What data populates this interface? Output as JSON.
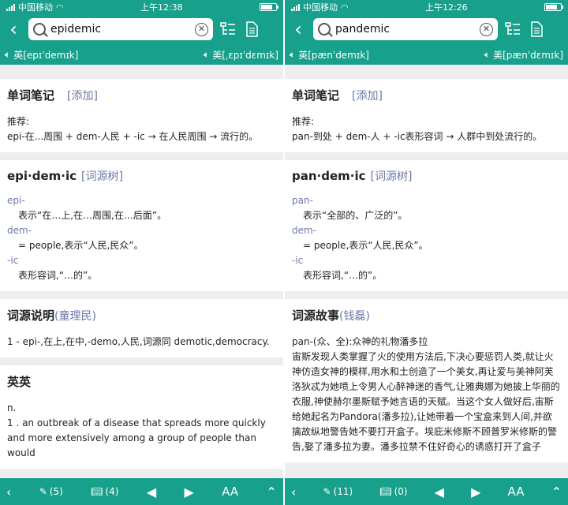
{
  "left": {
    "status": {
      "carrier": "中国移动",
      "time": "上午12:38"
    },
    "search": {
      "value": "epidemic"
    },
    "pron": {
      "uk": "英[epɪˈdemɪk]",
      "us": "美[ˌɛpɪˈdɛmɪk]"
    },
    "notes": {
      "title": "单词笔记",
      "add": "[添加]",
      "rec_label": "推荐:",
      "rec_text": "epi-在...周围 + dem-人民 + -ic → 在人民周围 → 流行的。"
    },
    "etym_tree": {
      "word": "epi·dem·ic",
      "link": "[词源树]",
      "parts": [
        {
          "prefix": "epi-",
          "desc": "表示“在…上,在…周围,在…后面”。"
        },
        {
          "prefix": "dem-",
          "desc": "= people,表示“人民,民众”。"
        },
        {
          "prefix": "-ic",
          "desc": "表形容词,“…的”。"
        }
      ]
    },
    "etym_expl": {
      "title": "词源说明",
      "author": "(童理民)",
      "text": "1 - epi-,在上,在中,-demo,人民,词源同 demotic,democracy."
    },
    "enen": {
      "title": "英英",
      "pos": "n.",
      "def": "1 . an outbreak of a disease that spreads more quickly and more extensively among a group of people than would"
    },
    "bottom": {
      "notes_count": "(5)",
      "book_count": "(4)",
      "font": "AA"
    }
  },
  "right": {
    "status": {
      "carrier": "中国移动",
      "time": "上午12:26"
    },
    "search": {
      "value": "pandemic"
    },
    "pron": {
      "uk": "英[pænˈdemɪk]",
      "us": "美[pænˈdɛmɪk]"
    },
    "notes": {
      "title": "单词笔记",
      "add": "[添加]",
      "rec_label": "推荐:",
      "rec_text": "pan-到处 + dem-人 + -ic表形容词 → 人群中到处流行的。"
    },
    "etym_tree": {
      "word": "pan·dem·ic",
      "link": "[词源树]",
      "parts": [
        {
          "prefix": "pan-",
          "desc": "表示“全部的、广泛的”。"
        },
        {
          "prefix": "dem-",
          "desc": "= people,表示“人民,民众”。"
        },
        {
          "prefix": "-ic",
          "desc": "表形容词,“…的”。"
        }
      ]
    },
    "story": {
      "title": "词源故事",
      "author": "(钱磊)",
      "subtitle": "pan-(众、全):众神的礼物潘多拉",
      "text": "宙斯发现人类掌握了火的使用方法后,下决心要惩罚人类,就让火神仿造女神的模样,用水和土创造了一个美女,再让爱与美神阿芙洛狄忒为她喷上令男人心醉神迷的香气,让雅典娜为她披上华丽的衣服,神使赫尔墨斯赋予她言语的天赋。当这个女人做好后,宙斯给她起名为Pandora(潘多拉),让她带着一个宝盒来到人间,并欲擒故纵地警告她不要打开盒子。埃庇米修斯不顾普罗米修斯的警告,娶了潘多拉为妻。潘多拉禁不住好奇心的诱惑打开了盒子"
    },
    "bottom": {
      "notes_count": "(11)",
      "book_count": "(0)",
      "font": "AA"
    }
  }
}
